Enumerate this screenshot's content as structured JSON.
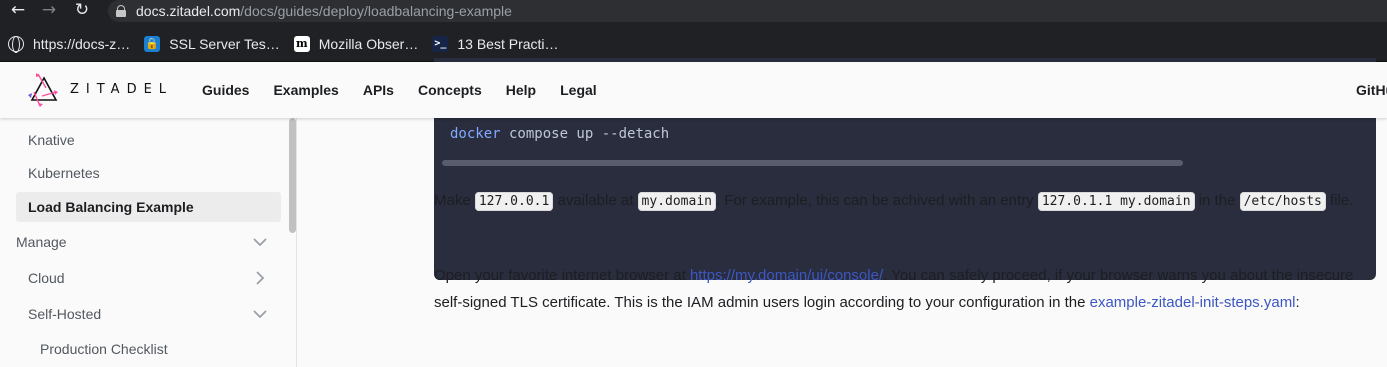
{
  "browser": {
    "url_host": "docs.zitadel.com",
    "url_path": "/docs/guides/deploy/loadbalancing-example",
    "bookmarks": [
      {
        "label": "https://docs-z…",
        "icon": "globe-icon"
      },
      {
        "label": "SSL Server Tes…",
        "icon": "ssl-labs-icon"
      },
      {
        "label": "Mozilla Obser…",
        "icon": "mozilla-icon"
      },
      {
        "label": "13 Best Practi…",
        "icon": "terminal-icon"
      }
    ]
  },
  "header": {
    "logo_text": "ZITADEL",
    "nav": [
      "Guides",
      "Examples",
      "APIs",
      "Concepts",
      "Help",
      "Legal"
    ],
    "github": "GitHu"
  },
  "sidebar": {
    "items": [
      {
        "label": "Knative"
      },
      {
        "label": "Kubernetes"
      },
      {
        "label": "Load Balancing Example"
      },
      {
        "label": "Manage"
      },
      {
        "label": "Cloud"
      },
      {
        "label": "Self-Hosted"
      },
      {
        "label": "Production Checklist"
      }
    ]
  },
  "code": {
    "command": "docker",
    "args": " compose up --detach"
  },
  "content": {
    "p1": {
      "t1": "Make ",
      "c1": "127.0.0.1",
      "t2": " available at ",
      "c2": "my.domain",
      "t3": ". For example, this can be achived with an entry ",
      "c3": "127.0.1.1 my.domain",
      "t4": " in the ",
      "c4": "/etc/hosts",
      "t5": " file."
    },
    "p2": {
      "t1": "Open your favorite internet browser at ",
      "link1": "https://my.domain/ui/console/",
      "t2": ". You can safely proceed, if your browser warns you about the insecure self-signed TLS certificate. This is the IAM admin users login according to your configuration in the ",
      "link2": "example-zitadel-init-steps.yaml",
      "t3": ":"
    }
  }
}
